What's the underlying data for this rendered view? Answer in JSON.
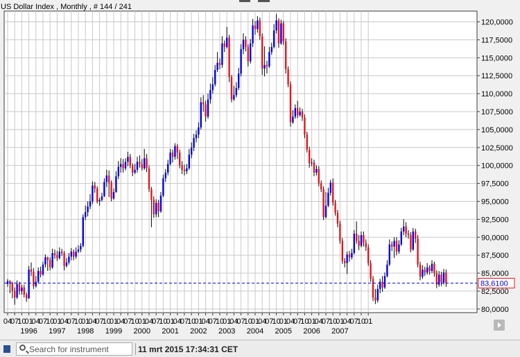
{
  "chart_data": {
    "type": "candlestick",
    "title": "US Dollar Index , Monthly , # 144 / 241",
    "ylim": [
      79.5,
      121.5
    ],
    "y_ticks": [
      80,
      82.5,
      85,
      87.5,
      90,
      92.5,
      95,
      97.5,
      100,
      102.5,
      105,
      107.5,
      110,
      112.5,
      115,
      117.5,
      120
    ],
    "y_tick_labels": [
      "80,0000",
      "82,5000",
      "85,0000",
      "87,5000",
      "90,0000",
      "92,5000",
      "95,0000",
      "97,5000",
      "100,0000",
      "102,5000",
      "105,0000",
      "107,5000",
      "110,0000",
      "112,5000",
      "115,0000",
      "117,5000",
      "120,0000"
    ],
    "x_month_ticks": [
      "04",
      "07",
      "10",
      "01",
      "04",
      "07",
      "10",
      "01",
      "04",
      "07",
      "10",
      "01",
      "04",
      "07",
      "10",
      "01",
      "04",
      "07",
      "10",
      "01",
      "04",
      "07",
      "10",
      "01",
      "04",
      "07",
      "10",
      "01",
      "04",
      "07",
      "10",
      "01",
      "04",
      "07",
      "10",
      "01",
      "04",
      "07",
      "10",
      "01",
      "04",
      "07",
      "10",
      "01",
      "04",
      "07",
      "10",
      "01",
      "04",
      "07",
      "10",
      "01"
    ],
    "x_year_labels": [
      "1996",
      "1997",
      "1998",
      "1999",
      "2000",
      "2001",
      "2002",
      "2003",
      "2004",
      "2005",
      "2006",
      "2007"
    ],
    "last_price": 83.61,
    "last_price_label": "83,6100",
    "up_color": "#0000ee",
    "down_color": "#e8141c",
    "grid": true,
    "candles": [
      [
        83.5,
        83.9,
        83.1,
        84.2
      ],
      [
        83.9,
        83.6,
        82.2,
        84.0
      ],
      [
        83.6,
        82.5,
        81.5,
        83.8
      ],
      [
        82.5,
        81.6,
        80.6,
        83.0
      ],
      [
        81.6,
        83.5,
        81.4,
        84.0
      ],
      [
        83.5,
        82.5,
        82.0,
        83.8
      ],
      [
        82.5,
        83.0,
        82.0,
        83.4
      ],
      [
        83.0,
        82.0,
        81.6,
        83.4
      ],
      [
        82.0,
        81.5,
        81.0,
        82.3
      ],
      [
        81.5,
        85.5,
        81.4,
        86.0
      ],
      [
        85.5,
        85.2,
        84.6,
        86.5
      ],
      [
        85.2,
        83.2,
        82.8,
        85.7
      ],
      [
        83.2,
        83.8,
        83.0,
        84.6
      ],
      [
        83.8,
        85.3,
        83.6,
        85.8
      ],
      [
        85.3,
        84.8,
        84.4,
        85.9
      ],
      [
        84.8,
        86.2,
        84.6,
        86.6
      ],
      [
        86.2,
        87.2,
        85.8,
        87.6
      ],
      [
        87.2,
        86.8,
        85.3,
        87.3
      ],
      [
        86.8,
        85.8,
        85.4,
        87.2
      ],
      [
        85.8,
        87.8,
        85.6,
        88.4
      ],
      [
        87.8,
        87.5,
        87.0,
        88.3
      ],
      [
        87.5,
        87.1,
        86.7,
        88.1
      ],
      [
        87.1,
        88.0,
        86.9,
        88.6
      ],
      [
        88.0,
        87.8,
        87.4,
        88.4
      ],
      [
        87.8,
        86.0,
        85.4,
        88.1
      ],
      [
        86.0,
        86.5,
        85.8,
        87.1
      ],
      [
        86.5,
        87.3,
        86.2,
        87.8
      ],
      [
        87.3,
        88.0,
        86.8,
        88.5
      ],
      [
        88.0,
        87.3,
        86.8,
        88.3
      ],
      [
        87.3,
        88.0,
        87.0,
        88.6
      ],
      [
        88.0,
        88.3,
        87.8,
        88.9
      ],
      [
        88.3,
        88.8,
        87.9,
        89.2
      ],
      [
        88.8,
        92.8,
        88.6,
        93.2
      ],
      [
        92.8,
        93.5,
        92.4,
        94.4
      ],
      [
        93.5,
        94.3,
        92.9,
        95.0
      ],
      [
        94.3,
        95.0,
        93.9,
        96.0
      ],
      [
        95.0,
        97.2,
        94.6,
        97.8
      ],
      [
        97.2,
        96.8,
        96.2,
        97.7
      ],
      [
        96.8,
        95.0,
        94.7,
        97.1
      ],
      [
        95.0,
        95.2,
        94.4,
        95.5
      ],
      [
        95.2,
        95.7,
        95.0,
        96.2
      ],
      [
        95.7,
        97.7,
        95.6,
        98.2
      ],
      [
        97.7,
        98.6,
        97.0,
        99.4
      ],
      [
        98.6,
        97.6,
        95.6,
        99.3
      ],
      [
        97.6,
        95.4,
        95.0,
        97.9
      ],
      [
        95.4,
        96.3,
        95.2,
        96.8
      ],
      [
        96.3,
        98.5,
        96.2,
        99.2
      ],
      [
        98.5,
        99.8,
        98.1,
        100.6
      ],
      [
        99.8,
        100.2,
        99.0,
        101.0
      ],
      [
        100.2,
        99.6,
        99.0,
        100.9
      ],
      [
        99.6,
        100.5,
        99.3,
        101.0
      ],
      [
        100.5,
        101.2,
        99.9,
        101.9
      ],
      [
        101.2,
        100.0,
        99.6,
        101.6
      ],
      [
        100.0,
        99.0,
        98.5,
        100.3
      ],
      [
        99.0,
        99.4,
        98.8,
        100.2
      ],
      [
        99.4,
        100.5,
        99.0,
        101.2
      ],
      [
        100.5,
        100.2,
        99.7,
        101.4
      ],
      [
        100.2,
        99.6,
        99.3,
        100.9
      ],
      [
        99.6,
        101.0,
        99.4,
        102.3
      ],
      [
        101.0,
        99.6,
        99.1,
        101.6
      ],
      [
        99.6,
        96.7,
        96.3,
        100.0
      ],
      [
        96.7,
        95.2,
        91.4,
        97.0
      ],
      [
        95.2,
        93.2,
        92.7,
        95.7
      ],
      [
        93.2,
        94.8,
        92.8,
        95.3
      ],
      [
        94.8,
        93.6,
        92.8,
        95.2
      ],
      [
        93.6,
        95.8,
        93.4,
        96.3
      ],
      [
        95.8,
        98.2,
        95.6,
        98.7
      ],
      [
        98.2,
        99.0,
        97.7,
        99.5
      ],
      [
        99.0,
        100.2,
        98.6,
        100.8
      ],
      [
        100.2,
        101.8,
        100.0,
        102.3
      ],
      [
        101.8,
        101.2,
        100.4,
        102.2
      ],
      [
        101.2,
        102.7,
        100.8,
        103.1
      ],
      [
        102.7,
        101.8,
        100.9,
        103.0
      ],
      [
        101.8,
        100.0,
        99.6,
        102.2
      ],
      [
        100.0,
        99.4,
        98.8,
        100.6
      ],
      [
        99.4,
        99.2,
        98.6,
        100.1
      ],
      [
        99.2,
        99.6,
        98.8,
        100.2
      ],
      [
        99.6,
        101.5,
        99.4,
        102.3
      ],
      [
        101.5,
        102.5,
        101.0,
        103.2
      ],
      [
        102.5,
        103.8,
        102.0,
        104.4
      ],
      [
        103.8,
        104.3,
        103.2,
        104.9
      ],
      [
        104.3,
        105.3,
        103.8,
        106.0
      ],
      [
        105.3,
        108.8,
        105.0,
        109.5
      ],
      [
        108.8,
        108.5,
        107.5,
        109.8
      ],
      [
        108.5,
        106.8,
        106.1,
        109.0
      ],
      [
        106.8,
        109.2,
        106.5,
        110.0
      ],
      [
        109.2,
        110.5,
        108.6,
        111.4
      ],
      [
        110.5,
        111.3,
        110.0,
        112.3
      ],
      [
        111.3,
        113.3,
        111.0,
        114.0
      ],
      [
        113.3,
        114.3,
        113.0,
        115.8
      ],
      [
        114.3,
        114.0,
        113.4,
        114.9
      ],
      [
        114.0,
        117.0,
        113.6,
        118.0
      ],
      [
        117.0,
        116.5,
        115.8,
        117.4
      ],
      [
        116.5,
        117.8,
        116.3,
        119.3
      ],
      [
        117.8,
        112.3,
        111.6,
        118.2
      ],
      [
        112.3,
        109.2,
        108.8,
        112.6
      ],
      [
        109.2,
        109.8,
        109.0,
        111.1
      ],
      [
        109.8,
        110.8,
        109.5,
        111.6
      ],
      [
        110.8,
        112.8,
        110.5,
        113.6
      ],
      [
        112.8,
        116.2,
        112.4,
        116.9
      ],
      [
        116.2,
        117.5,
        115.5,
        118.4
      ],
      [
        117.5,
        116.5,
        115.9,
        118.0
      ],
      [
        116.5,
        114.5,
        113.8,
        116.9
      ],
      [
        114.5,
        117.0,
        114.2,
        117.6
      ],
      [
        117.0,
        119.5,
        116.5,
        120.4
      ],
      [
        119.5,
        119.0,
        118.2,
        120.1
      ],
      [
        119.0,
        120.2,
        118.5,
        120.8
      ],
      [
        120.2,
        118.0,
        117.5,
        120.6
      ],
      [
        118.0,
        113.5,
        112.6,
        118.4
      ],
      [
        113.5,
        114.0,
        112.4,
        116.6
      ],
      [
        114.0,
        113.8,
        112.8,
        114.6
      ],
      [
        113.8,
        115.8,
        113.6,
        116.5
      ],
      [
        115.8,
        116.5,
        115.4,
        117.1
      ],
      [
        116.5,
        118.8,
        116.3,
        119.7
      ],
      [
        118.8,
        120.2,
        118.4,
        121.1
      ],
      [
        120.2,
        117.0,
        116.4,
        120.5
      ],
      [
        117.0,
        119.8,
        116.8,
        120.3
      ],
      [
        119.8,
        117.3,
        116.8,
        120.1
      ],
      [
        117.3,
        113.4,
        112.8,
        117.7
      ],
      [
        113.4,
        111.3,
        110.9,
        113.8
      ],
      [
        111.3,
        106.0,
        105.4,
        111.7
      ],
      [
        106.0,
        106.8,
        105.8,
        107.7
      ],
      [
        106.8,
        108.0,
        106.5,
        108.5
      ],
      [
        108.0,
        107.0,
        106.6,
        109.0
      ],
      [
        107.0,
        107.5,
        106.8,
        108.1
      ],
      [
        107.5,
        106.7,
        106.2,
        107.9
      ],
      [
        106.7,
        104.3,
        103.8,
        107.1
      ],
      [
        104.3,
        102.2,
        101.8,
        104.7
      ],
      [
        102.2,
        100.3,
        99.7,
        102.6
      ],
      [
        100.3,
        100.4,
        99.9,
        101.0
      ],
      [
        100.4,
        99.0,
        98.5,
        100.8
      ],
      [
        99.0,
        99.5,
        98.6,
        100.0
      ],
      [
        99.5,
        97.5,
        97.1,
        99.9
      ],
      [
        97.5,
        96.7,
        96.3,
        97.9
      ],
      [
        96.7,
        92.8,
        92.4,
        97.1
      ],
      [
        92.8,
        94.4,
        92.6,
        96.3
      ],
      [
        94.4,
        96.2,
        94.2,
        96.9
      ],
      [
        96.2,
        97.6,
        95.8,
        98.0
      ],
      [
        97.6,
        94.8,
        94.4,
        98.2
      ],
      [
        94.8,
        93.4,
        93.0,
        95.2
      ],
      [
        93.4,
        91.9,
        91.4,
        93.8
      ],
      [
        91.9,
        89.5,
        89.1,
        92.3
      ],
      [
        89.5,
        86.7,
        86.3,
        89.9
      ],
      [
        86.7,
        86.4,
        85.8,
        87.1
      ],
      [
        86.4,
        87.6,
        84.9,
        88.0
      ],
      [
        87.6,
        87.2,
        86.6,
        88.1
      ],
      [
        87.2,
        87.8,
        86.9,
        88.4
      ],
      [
        87.8,
        90.5,
        87.6,
        91.0
      ],
      [
        90.5,
        89.5,
        89.1,
        92.2
      ],
      [
        89.5,
        88.8,
        88.2,
        90.3
      ],
      [
        88.8,
        90.3,
        88.6,
        90.8
      ],
      [
        90.3,
        89.2,
        88.7,
        90.8
      ],
      [
        89.2,
        88.6,
        88.1,
        89.7
      ],
      [
        88.6,
        86.4,
        86.0,
        89.0
      ],
      [
        86.4,
        84.2,
        83.8,
        86.8
      ],
      [
        84.2,
        81.6,
        81.1,
        84.6
      ],
      [
        81.6,
        81.2,
        80.7,
        82.8
      ],
      [
        81.2,
        82.8,
        80.9,
        83.4
      ],
      [
        82.8,
        83.8,
        82.2,
        84.2
      ],
      [
        83.8,
        83.0,
        82.4,
        84.6
      ],
      [
        83.0,
        84.6,
        82.8,
        85.1
      ],
      [
        84.6,
        86.2,
        84.4,
        86.8
      ],
      [
        86.2,
        89.0,
        86.0,
        89.7
      ],
      [
        89.0,
        88.7,
        88.1,
        89.4
      ],
      [
        88.7,
        89.5,
        87.1,
        90.0
      ],
      [
        89.5,
        88.0,
        87.5,
        90.0
      ],
      [
        88.0,
        89.0,
        87.7,
        89.6
      ],
      [
        89.0,
        90.8,
        88.8,
        91.3
      ],
      [
        90.8,
        91.5,
        90.3,
        92.5
      ],
      [
        91.5,
        90.5,
        90.0,
        92.1
      ],
      [
        90.5,
        90.3,
        89.8,
        91.0
      ],
      [
        90.3,
        88.3,
        87.9,
        90.7
      ],
      [
        88.3,
        90.8,
        88.1,
        91.3
      ],
      [
        90.8,
        89.8,
        89.2,
        91.2
      ],
      [
        89.8,
        86.2,
        85.8,
        90.3
      ],
      [
        86.2,
        84.5,
        84.0,
        86.6
      ],
      [
        84.5,
        85.5,
        84.2,
        86.1
      ],
      [
        85.5,
        85.1,
        84.6,
        85.9
      ],
      [
        85.1,
        85.8,
        84.8,
        86.4
      ],
      [
        85.8,
        85.3,
        84.8,
        86.1
      ],
      [
        85.3,
        86.3,
        85.0,
        86.8
      ],
      [
        86.3,
        85.0,
        84.5,
        86.6
      ],
      [
        85.0,
        83.4,
        82.9,
        85.4
      ],
      [
        83.4,
        84.8,
        83.1,
        85.3
      ],
      [
        84.8,
        83.7,
        83.2,
        85.2
      ],
      [
        83.7,
        85.1,
        83.4,
        85.6
      ],
      [
        85.1,
        83.6,
        83.1,
        85.5
      ]
    ]
  },
  "statusbar": {
    "search_placeholder": "Search for instrument",
    "timestamp": "11 mrt 2015 17:34:31 CET"
  },
  "ui": {
    "background": "#ffffff",
    "grid_color": "#c8c8c8",
    "axis_color": "#3a3a3a",
    "last_price_line_color": "#0000dd",
    "last_price_box_color": "#e8141c"
  }
}
